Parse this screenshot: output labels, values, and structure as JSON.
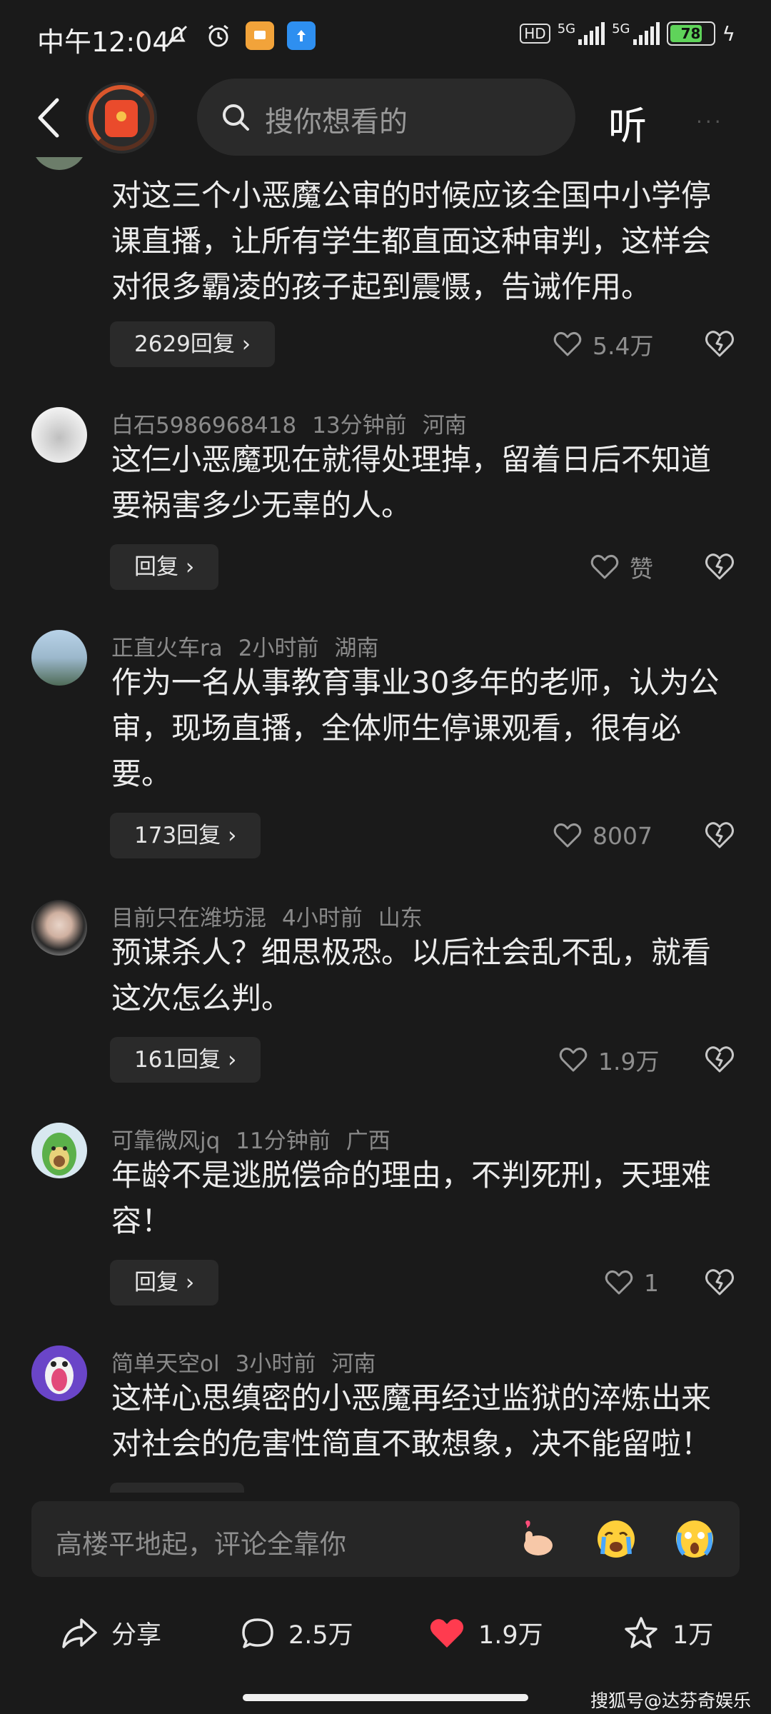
{
  "status_bar": {
    "time": "中午12:04",
    "network_1": "5G",
    "network_2": "5G",
    "hd_label": "HD",
    "battery": "78",
    "icons": [
      "mute-bell-icon",
      "alarm-icon",
      "app-notification-icon",
      "upload-notification-icon"
    ]
  },
  "header": {
    "search_placeholder": "搜你想看的",
    "listen_label": "听",
    "more_label": "···"
  },
  "comments": [
    {
      "text": "对这三个小恶魔公审的时候应该全国中小学停课直播，让所有学生都直面这种审判，这样会对很多霸凌的孩子起到震慑，告诫作用。",
      "reply_label": "2629回复",
      "likes": "5.4万"
    },
    {
      "username": "白石5986968418",
      "time": "13分钟前",
      "location": "河南",
      "text": "这仨小恶魔现在就得处理掉，留着日后不知道要祸害多少无辜的人。",
      "reply_label": "回复",
      "likes": "赞"
    },
    {
      "username": "正直火车ra",
      "time": "2小时前",
      "location": "湖南",
      "text": "作为一名从事教育事业30多年的老师，认为公审，现场直播，全体师生停课观看，很有必要。",
      "reply_label": "173回复",
      "likes": "8007"
    },
    {
      "username": "目前只在潍坊混",
      "time": "4小时前",
      "location": "山东",
      "text": "预谋杀人？细思极恐。以后社会乱不乱，就看这次怎么判。",
      "reply_label": "161回复",
      "likes": "1.9万"
    },
    {
      "username": "可靠微风jq",
      "time": "11分钟前",
      "location": "广西",
      "text": "年龄不是逃脱偿命的理由，不判死刑，天理难容！",
      "reply_label": "回复",
      "likes": "1"
    },
    {
      "username": "简单天空ol",
      "time": "3小时前",
      "location": "河南",
      "text": "这样心思缜密的小恶魔再经过监狱的淬炼出来对社会的危害性简直不敢想象，决不能留啦！"
    }
  ],
  "comment_input": {
    "placeholder": "高楼平地起，评论全靠你",
    "emojis": [
      "finger-heart-emoji",
      "crying-emoji",
      "shocked-crying-emoji"
    ]
  },
  "bottom_bar": {
    "share_label": "分享",
    "comments_count": "2.5万",
    "likes_count": "1.9万",
    "favorites_count": "1万"
  },
  "watermark": "搜狐号@达芬奇娱乐",
  "colors": {
    "background": "#1a1a1a",
    "like_active": "#ff3b4f",
    "meta_text": "#8a8a8a",
    "brand_red": "#ea4b2c"
  }
}
